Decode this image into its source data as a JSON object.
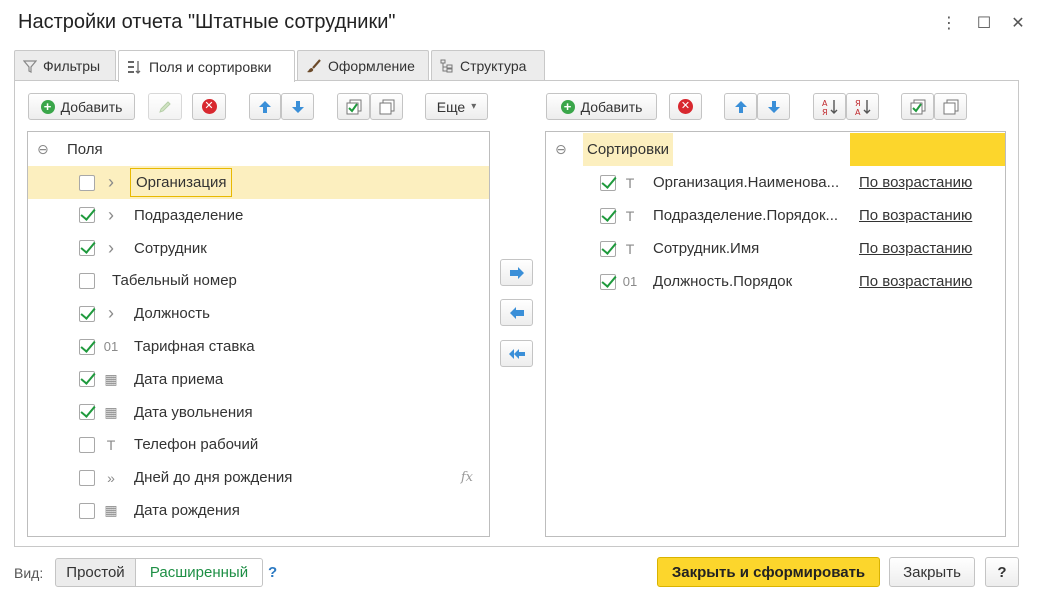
{
  "window": {
    "title": "Настройки отчета \"Штатные сотрудники\"",
    "more_icon": "⋮",
    "maximize_icon": "☐",
    "close_icon": "✕"
  },
  "tabs": [
    {
      "label": "Фильтры",
      "icon": "filter-icon",
      "active": false
    },
    {
      "label": "Поля и сортировки",
      "icon": "fields-sort-icon",
      "active": true
    },
    {
      "label": "Оформление",
      "icon": "brush-icon",
      "active": false
    },
    {
      "label": "Структура",
      "icon": "structure-icon",
      "active": false
    }
  ],
  "left_toolbar": {
    "add_label": "Добавить",
    "more_label": "Еще",
    "more_arrow": "▾"
  },
  "right_toolbar": {
    "add_label": "Добавить"
  },
  "fields_tree": {
    "root_label": "Поля",
    "collapse_glyph": "⊖",
    "items": [
      {
        "label": "Организация",
        "checked": false,
        "type": "expand",
        "glyph": "›",
        "selected": true
      },
      {
        "label": "Подразделение",
        "checked": true,
        "type": "expand",
        "glyph": "›",
        "selected": false
      },
      {
        "label": "Сотрудник",
        "checked": true,
        "type": "expand",
        "glyph": "›",
        "selected": false
      },
      {
        "label": "Табельный номер",
        "checked": false,
        "type": "none",
        "glyph": "",
        "selected": false
      },
      {
        "label": "Должность",
        "checked": true,
        "type": "expand",
        "glyph": "›",
        "selected": false
      },
      {
        "label": "Тарифная ставка",
        "checked": true,
        "type": "number",
        "glyph": "01",
        "selected": false
      },
      {
        "label": "Дата приема",
        "checked": true,
        "type": "date",
        "glyph": "▦",
        "selected": false
      },
      {
        "label": "Дата увольнения",
        "checked": true,
        "type": "date",
        "glyph": "▦",
        "selected": false
      },
      {
        "label": "Телефон рабочий",
        "checked": false,
        "type": "text",
        "glyph": "T",
        "selected": false
      },
      {
        "label": "Дней до дня рождения",
        "checked": false,
        "type": "calc",
        "glyph": "»",
        "selected": false,
        "fx": "fx"
      },
      {
        "label": "Дата рождения",
        "checked": false,
        "type": "date",
        "glyph": "▦",
        "selected": false
      }
    ]
  },
  "sort_tree": {
    "root_label": "Сортировки",
    "collapse_glyph": "⊖",
    "items": [
      {
        "label": "Организация.Наименова...",
        "checked": true,
        "glyph": "T",
        "direction": "По возрастанию"
      },
      {
        "label": "Подразделение.Порядок...",
        "checked": true,
        "glyph": "T",
        "direction": "По возрастанию"
      },
      {
        "label": "Сотрудник.Имя",
        "checked": true,
        "glyph": "T",
        "direction": "По возрастанию"
      },
      {
        "label": "Должность.Порядок",
        "checked": true,
        "glyph": "01",
        "direction": "По возрастанию"
      }
    ]
  },
  "bottom": {
    "view_label": "Вид:",
    "simple_label": "Простой",
    "extended_label": "Расширенный",
    "help_label": "?",
    "close_build_label": "Закрыть и сформировать",
    "close_label": "Закрыть",
    "help_button_label": "?"
  },
  "colors": {
    "accent_yellow": "#fcd62c",
    "selection": "#fcefbf",
    "check_green": "#1f9a3d",
    "link_green": "#1e8f45",
    "arrow_blue": "#3a8fd8"
  }
}
